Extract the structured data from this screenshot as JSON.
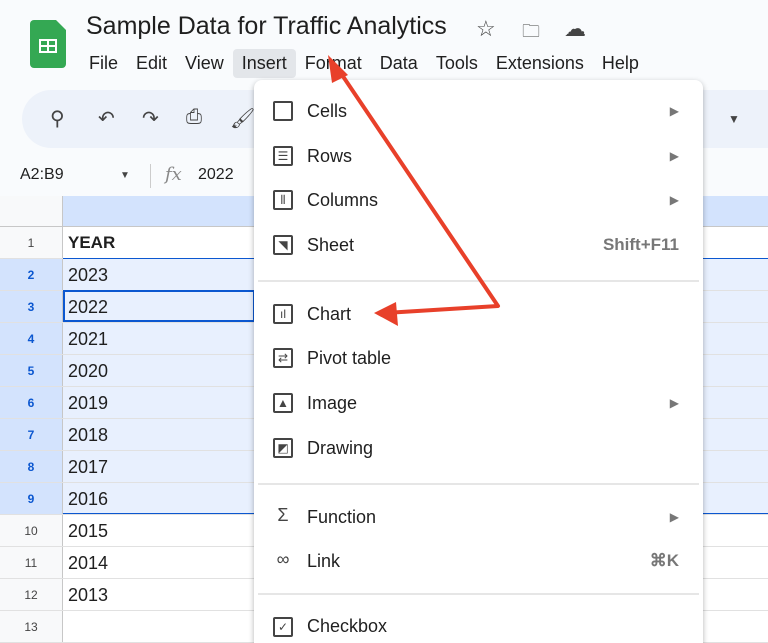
{
  "app": {
    "title": "Sample Data for Traffic Analytics",
    "brand_color": "#34a853"
  },
  "menubar": [
    "File",
    "Edit",
    "View",
    "Insert",
    "Format",
    "Data",
    "Tools",
    "Extensions",
    "Help"
  ],
  "formula": {
    "name_box": "A2:B9",
    "fx": "fx",
    "value": "2022"
  },
  "rows": [
    {
      "n": "1",
      "v": "YEAR"
    },
    {
      "n": "2",
      "v": "2023"
    },
    {
      "n": "3",
      "v": "2022"
    },
    {
      "n": "4",
      "v": "2021"
    },
    {
      "n": "5",
      "v": "2020"
    },
    {
      "n": "6",
      "v": "2019"
    },
    {
      "n": "7",
      "v": "2018"
    },
    {
      "n": "8",
      "v": "2017"
    },
    {
      "n": "9",
      "v": "2016"
    },
    {
      "n": "10",
      "v": "2015"
    },
    {
      "n": "11",
      "v": "2014"
    },
    {
      "n": "12",
      "v": "2013"
    },
    {
      "n": "13",
      "v": ""
    }
  ],
  "insert_menu": [
    {
      "label": "Cells",
      "icon": "cells-icon",
      "submenu": true
    },
    {
      "label": "Rows",
      "icon": "rows-icon",
      "submenu": true
    },
    {
      "label": "Columns",
      "icon": "columns-icon",
      "submenu": true
    },
    {
      "label": "Sheet",
      "icon": "sheet-icon",
      "shortcut": "Shift+F11"
    },
    {
      "label": "Chart",
      "icon": "chart-icon"
    },
    {
      "label": "Pivot table",
      "icon": "pivot-table-icon"
    },
    {
      "label": "Image",
      "icon": "image-icon",
      "submenu": true
    },
    {
      "label": "Drawing",
      "icon": "drawing-icon"
    },
    {
      "label": "Function",
      "icon": "sigma-icon",
      "submenu": true
    },
    {
      "label": "Link",
      "icon": "link-icon",
      "shortcut": "⌘K"
    },
    {
      "label": "Checkbox",
      "icon": "checkbox-icon"
    }
  ],
  "annotation_color": "#e8402a"
}
